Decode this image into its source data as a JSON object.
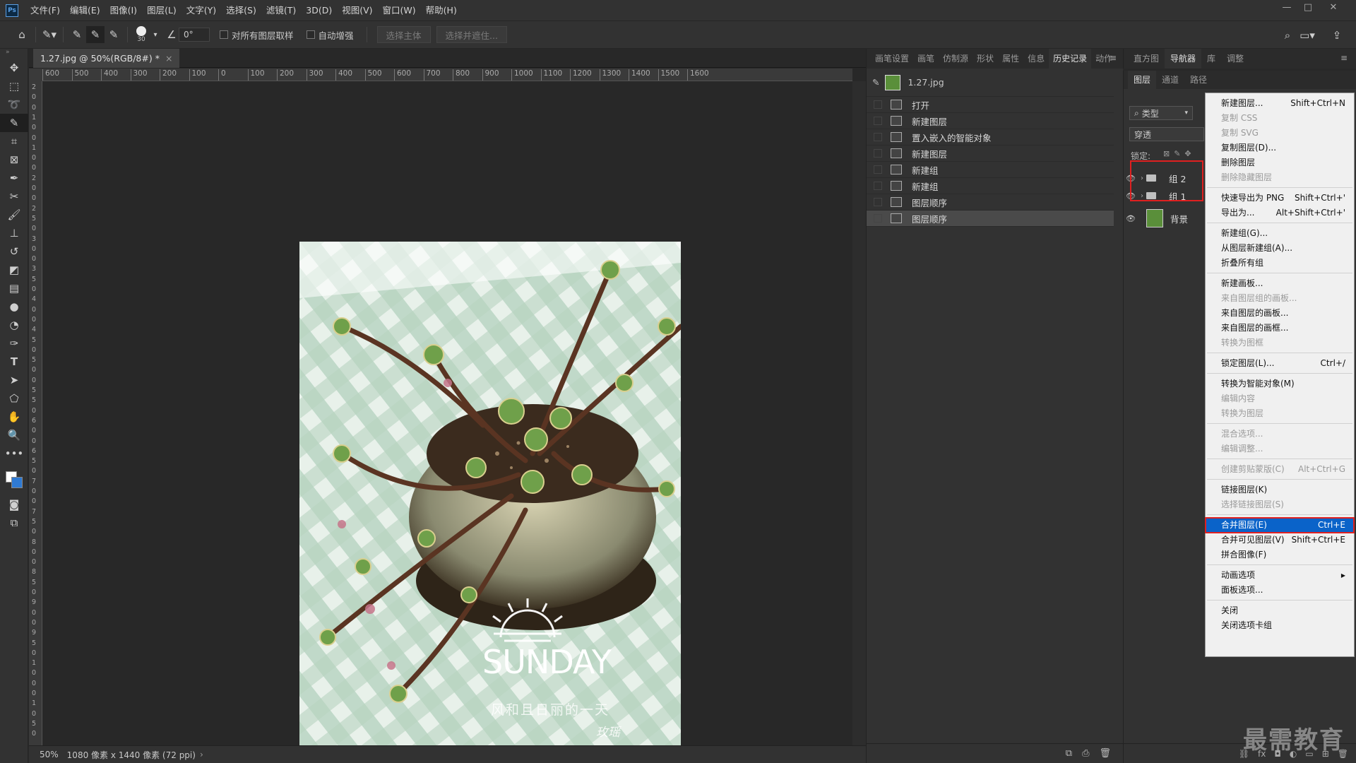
{
  "menubar": {
    "logo": "Ps",
    "items": [
      "文件(F)",
      "编辑(E)",
      "图像(I)",
      "图层(L)",
      "文字(Y)",
      "选择(S)",
      "滤镜(T)",
      "3D(D)",
      "视图(V)",
      "窗口(W)",
      "帮助(H)"
    ],
    "controls": [
      "—",
      "□",
      "✕"
    ]
  },
  "options": {
    "brush_size": "30",
    "angle": "0°",
    "sample_all_layers": "对所有图层取样",
    "auto_enhance": "自动增强",
    "select_subject": "选择主体",
    "select_mask": "选择并遮住..."
  },
  "document": {
    "tab_label": "1.27.jpg @ 50%(RGB/8#) *",
    "close": "×"
  },
  "ruler_h": [
    "600",
    "500",
    "400",
    "300",
    "200",
    "100",
    "0",
    "100",
    "200",
    "300",
    "400",
    "500",
    "600",
    "700",
    "800",
    "900",
    "1000",
    "1100",
    "1200",
    "1300",
    "1400",
    "1500",
    "1600"
  ],
  "ruler_v": [
    "2",
    "0",
    "0",
    "1",
    "0",
    "0",
    "1",
    "0",
    "0",
    "2",
    "0",
    "0",
    "2",
    "5",
    "0",
    "3",
    "0",
    "0",
    "3",
    "5",
    "0",
    "4",
    "0",
    "0",
    "4",
    "5",
    "0",
    "5",
    "0",
    "0",
    "5",
    "5",
    "0",
    "6",
    "0",
    "0",
    "6",
    "5",
    "0",
    "7",
    "0",
    "0",
    "7",
    "5",
    "0",
    "8",
    "0",
    "0",
    "8",
    "5",
    "0",
    "9",
    "0",
    "0",
    "9",
    "5",
    "0",
    "1",
    "0",
    "0",
    "0",
    "1",
    "0",
    "5",
    "0"
  ],
  "image": {
    "title": "SUNDAY",
    "subtitle": "风和且日丽的一天",
    "signature": "玫瑶"
  },
  "status": {
    "zoom": "50%",
    "info": "1080 像素 x 1440 像素 (72 ppi)",
    "arrow": "›"
  },
  "history_tabs": [
    "画笔设置",
    "画笔",
    "仿制源",
    "形状",
    "属性",
    "信息",
    "历史记录",
    "动作"
  ],
  "history": {
    "snapshot": "1.27.jpg",
    "items": [
      "打开",
      "新建图层",
      "置入嵌入的智能对象",
      "新建图层",
      "新建组",
      "新建组",
      "图层顺序",
      "图层顺序"
    ]
  },
  "nav_tabs": [
    "直方图",
    "导航器",
    "库",
    "调整"
  ],
  "layers": {
    "tabs": [
      "图层",
      "通道",
      "路径"
    ],
    "filter": "类型",
    "blend": "穿透",
    "lock_label": "锁定:",
    "items": [
      "组 2",
      "组 1",
      "背景"
    ]
  },
  "context_menu": [
    {
      "label": "新建图层...",
      "shortcut": "Shift+Ctrl+N",
      "disabled": false
    },
    {
      "label": "复制 CSS",
      "shortcut": "",
      "disabled": true
    },
    {
      "label": "复制 SVG",
      "shortcut": "",
      "disabled": true
    },
    {
      "label": "复制图层(D)...",
      "shortcut": "",
      "disabled": false
    },
    {
      "label": "删除图层",
      "shortcut": "",
      "disabled": false
    },
    {
      "label": "删除隐藏图层",
      "shortcut": "",
      "disabled": true
    },
    {
      "sep": true
    },
    {
      "label": "快速导出为 PNG",
      "shortcut": "Shift+Ctrl+'",
      "disabled": false
    },
    {
      "label": "导出为...",
      "shortcut": "Alt+Shift+Ctrl+'",
      "disabled": false
    },
    {
      "sep": true
    },
    {
      "label": "新建组(G)...",
      "shortcut": "",
      "disabled": false
    },
    {
      "label": "从图层新建组(A)...",
      "shortcut": "",
      "disabled": false
    },
    {
      "label": "折叠所有组",
      "shortcut": "",
      "disabled": false
    },
    {
      "sep": true
    },
    {
      "label": "新建画板...",
      "shortcut": "",
      "disabled": false
    },
    {
      "label": "来自图层组的画板...",
      "shortcut": "",
      "disabled": true
    },
    {
      "label": "来自图层的画板...",
      "shortcut": "",
      "disabled": false
    },
    {
      "label": "来自图层的画框...",
      "shortcut": "",
      "disabled": false
    },
    {
      "label": "转换为图框",
      "shortcut": "",
      "disabled": true
    },
    {
      "sep": true
    },
    {
      "label": "锁定图层(L)...",
      "shortcut": "Ctrl+/",
      "disabled": false
    },
    {
      "sep": true
    },
    {
      "label": "转换为智能对象(M)",
      "shortcut": "",
      "disabled": false
    },
    {
      "label": "编辑内容",
      "shortcut": "",
      "disabled": true
    },
    {
      "label": "转换为图层",
      "shortcut": "",
      "disabled": true
    },
    {
      "sep": true
    },
    {
      "label": "混合选项...",
      "shortcut": "",
      "disabled": true
    },
    {
      "label": "编辑调整...",
      "shortcut": "",
      "disabled": true
    },
    {
      "sep": true
    },
    {
      "label": "创建剪贴蒙版(C)",
      "shortcut": "Alt+Ctrl+G",
      "disabled": true
    },
    {
      "sep": true
    },
    {
      "label": "链接图层(K)",
      "shortcut": "",
      "disabled": false
    },
    {
      "label": "选择链接图层(S)",
      "shortcut": "",
      "disabled": true
    },
    {
      "sep": true
    },
    {
      "label": "合并图层(E)",
      "shortcut": "Ctrl+E",
      "disabled": false,
      "highlight": true
    },
    {
      "label": "合并可见图层(V)",
      "shortcut": "Shift+Ctrl+E",
      "disabled": false
    },
    {
      "label": "拼合图像(F)",
      "shortcut": "",
      "disabled": false
    },
    {
      "sep": true
    },
    {
      "label": "动画选项",
      "shortcut": "",
      "disabled": false,
      "submenu": true
    },
    {
      "label": "面板选项...",
      "shortcut": "",
      "disabled": false
    },
    {
      "sep": true
    },
    {
      "label": "关闭",
      "shortcut": "",
      "disabled": false
    },
    {
      "label": "关闭选项卡组",
      "shortcut": "",
      "disabled": false
    }
  ],
  "watermark": "最需教育",
  "colors": {
    "accent": "#0a63c9",
    "highlight_border": "#e02020"
  }
}
